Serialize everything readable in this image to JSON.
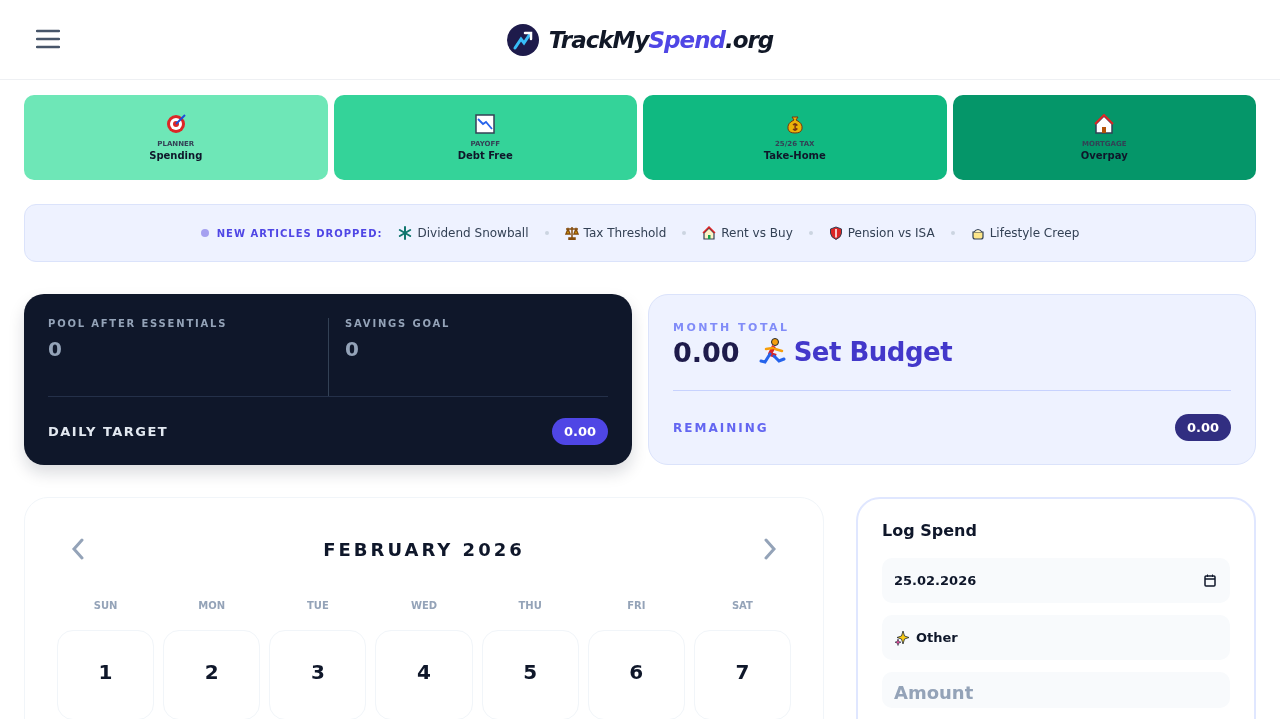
{
  "header": {
    "logo": [
      "TrackMy",
      "Spend",
      ".org"
    ]
  },
  "tools": [
    {
      "caption": "PLANNER",
      "label": "Spending",
      "color": "#6ee7b7"
    },
    {
      "caption": "PAYOFF",
      "label": "Debt Free",
      "color": "#34d399"
    },
    {
      "caption": "25/26 TAX",
      "label": "Take-Home",
      "color": "#10b981"
    },
    {
      "caption": "MORTGAGE",
      "label": "Overpay",
      "color": "#059669"
    }
  ],
  "articles": {
    "heading": "NEW ARTICLES DROPPED:",
    "items": [
      "Dividend Snowball",
      "Tax Threshold",
      "Rent vs Buy",
      "Pension vs ISA",
      "Lifestyle Creep"
    ]
  },
  "summary": {
    "pool_label": "POOL AFTER ESSENTIALS",
    "pool_value": "0",
    "goal_label": "SAVINGS GOAL",
    "goal_value": "0",
    "daily_label": "DAILY TARGET",
    "daily_value": "0.00"
  },
  "month": {
    "label": "MONTH TOTAL",
    "total": "0.00",
    "budget_link": "Set Budget",
    "remaining_label": "REMAINING",
    "remaining_value": "0.00"
  },
  "calendar": {
    "title": "FEBRUARY 2026",
    "weekdays": [
      "SUN",
      "MON",
      "TUE",
      "WED",
      "THU",
      "FRI",
      "SAT"
    ],
    "days": [
      "1",
      "2",
      "3",
      "4",
      "5",
      "6",
      "7"
    ]
  },
  "log": {
    "title": "Log Spend",
    "date": "25.02.2026",
    "category": "Other",
    "amount_placeholder": "Amount"
  }
}
